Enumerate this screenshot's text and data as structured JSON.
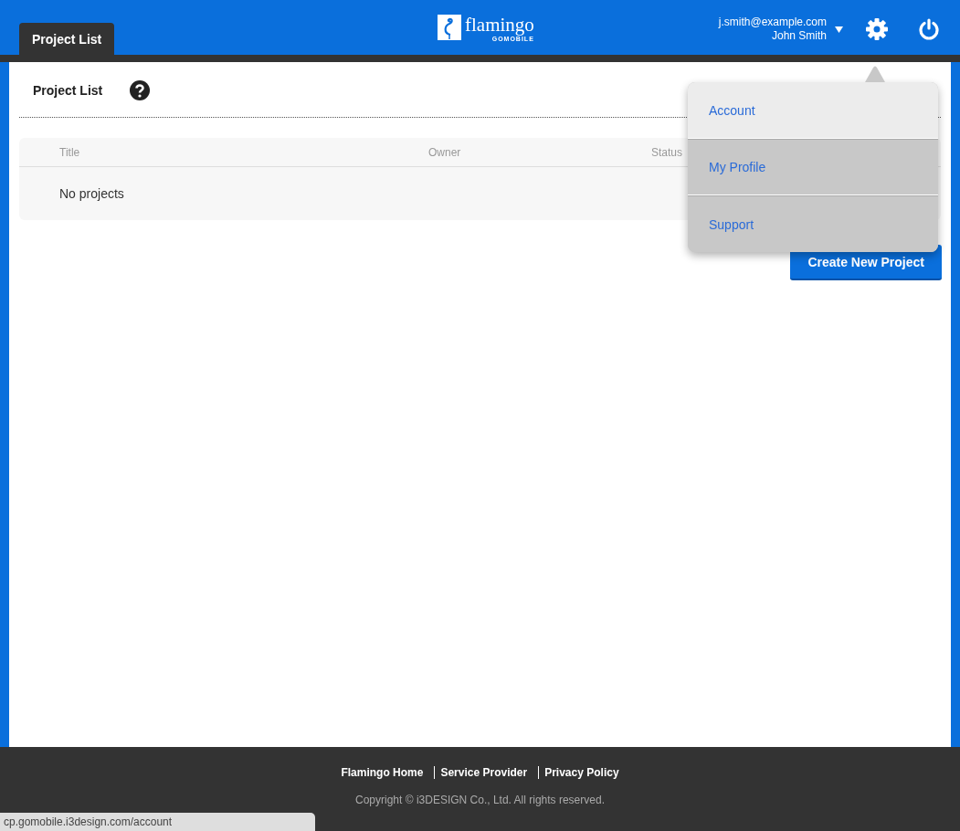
{
  "header": {
    "tabs": [
      {
        "label": "Project List",
        "selected": true
      }
    ],
    "logo": {
      "name": "flamingo",
      "subtitle": "GOMOBILE"
    },
    "user": {
      "email": "j.smith@example.com",
      "name": "John Smith"
    }
  },
  "user_menu": {
    "items": [
      {
        "label": "Account",
        "selected": true
      },
      {
        "label": "My Profile",
        "selected": false
      },
      {
        "label": "Support",
        "selected": false
      }
    ]
  },
  "page": {
    "title": "Project List",
    "table": {
      "columns": [
        "Title",
        "Owner",
        "Status"
      ],
      "empty_text": "No projects"
    },
    "create_button": "Create New Project"
  },
  "footer": {
    "links": [
      "Flamingo Home",
      "Service Provider",
      "Privacy Policy"
    ],
    "copyright": "Copyright © i3DESIGN Co., Ltd. All rights reserved."
  },
  "status_bar": {
    "url": "cp.gomobile.i3design.com/account"
  }
}
